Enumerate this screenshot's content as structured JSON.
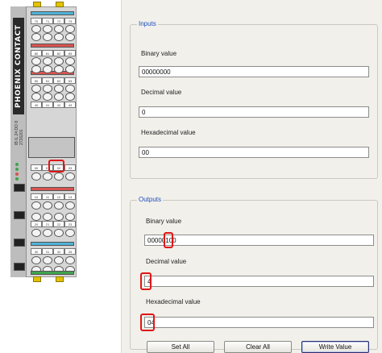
{
  "inputs": {
    "title": "Inputs",
    "binary_label": "Binary value",
    "binary_value": "00000000",
    "decimal_label": "Decimal value",
    "decimal_value": "0",
    "hex_label": "Hexadecimal value",
    "hex_value": "00"
  },
  "outputs": {
    "title": "Outputs",
    "binary_label": "Binary value",
    "binary_value": "00000100",
    "decimal_label": "Decimal value",
    "decimal_value": "4",
    "hex_label": "Hexadecimal value",
    "hex_value": "04"
  },
  "buttons": {
    "set_all": "Set All",
    "clear_all": "Clear All",
    "write_value": "Write Value"
  },
  "device": {
    "brand": "PHOENIX CONTACT",
    "model": "IB IL 24 DO 8 2726201",
    "terminal_labels": [
      "70",
      "71",
      "72",
      "73",
      "80",
      "81",
      "82",
      "83",
      "50",
      "51",
      "52",
      "53",
      "40",
      "41",
      "42",
      "43"
    ],
    "output_labels": [
      "00",
      "01",
      "02",
      "03",
      "10",
      "11",
      "12",
      "13",
      "20",
      "21",
      "22",
      "23",
      "30",
      "31",
      "32",
      "33"
    ]
  },
  "colors": {
    "group_title": "#1f4fbf",
    "highlight": "#e01616",
    "panel_bg": "#f1f0ea",
    "terminal_red": "#d9534f",
    "terminal_blue": "#4fb3d9",
    "terminal_green": "#3fa34d",
    "clip_yellow": "#e3c300"
  }
}
